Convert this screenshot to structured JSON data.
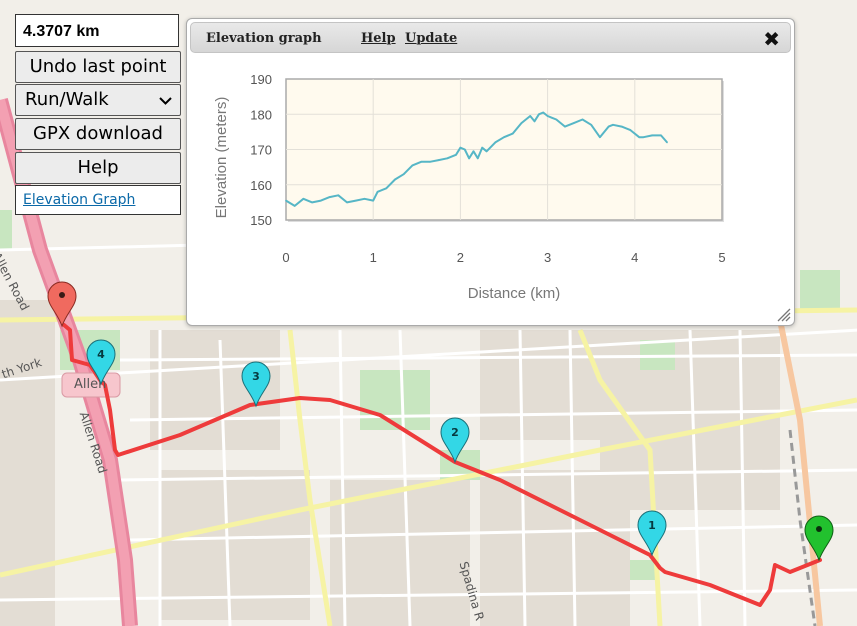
{
  "distance": "4.3707 km",
  "buttons": {
    "undo": "Undo last point",
    "mode": "Run/Walk",
    "gpx": "GPX download",
    "help": "Help"
  },
  "elevation_link": "Elevation Graph",
  "dialog": {
    "title": "Elevation graph",
    "help": "Help",
    "update": "Update",
    "close": "✖"
  },
  "map_labels": {
    "allen_road_north": "Allen Road",
    "allen_road_south": "Allen Road",
    "allen_station": "Allen",
    "north_york": "th York",
    "spadina": "Spadina R"
  },
  "markers": [
    {
      "label": "",
      "kind": "start-red"
    },
    {
      "label": "4",
      "kind": "waypoint"
    },
    {
      "label": "3",
      "kind": "waypoint"
    },
    {
      "label": "2",
      "kind": "waypoint"
    },
    {
      "label": "1",
      "kind": "waypoint"
    },
    {
      "label": "",
      "kind": "end-green"
    }
  ],
  "colors": {
    "route": "#ee3b3b",
    "waypoint": "#33d7e6",
    "start_marker": "#f06a5f",
    "end_marker": "#22c12e",
    "elevation_line": "#56b6c6"
  },
  "chart_data": {
    "type": "line",
    "xlabel": "Distance (km)",
    "ylabel": "Elevation (meters)",
    "xlim": [
      0,
      5
    ],
    "ylim": [
      150,
      190
    ],
    "xticks": [
      "0",
      "1",
      "2",
      "3",
      "4",
      "5"
    ],
    "yticks": [
      "150",
      "160",
      "170",
      "180",
      "190"
    ],
    "grid": true,
    "series": [
      {
        "name": "",
        "x": [
          0,
          0.1,
          0.2,
          0.3,
          0.4,
          0.5,
          0.6,
          0.7,
          0.8,
          0.9,
          1.0,
          1.05,
          1.15,
          1.25,
          1.35,
          1.45,
          1.55,
          1.65,
          1.75,
          1.85,
          1.95,
          2.0,
          2.05,
          2.1,
          2.15,
          2.2,
          2.25,
          2.3,
          2.4,
          2.5,
          2.6,
          2.7,
          2.8,
          2.85,
          2.9,
          2.95,
          3.0,
          3.05,
          3.1,
          3.2,
          3.3,
          3.4,
          3.5,
          3.6,
          3.7,
          3.75,
          3.85,
          3.95,
          4.05,
          4.1,
          4.2,
          4.3,
          4.37
        ],
        "y": [
          155.5,
          154,
          156,
          155,
          155.5,
          156.5,
          157,
          155,
          155.5,
          156,
          155.5,
          158,
          159,
          161.5,
          163,
          165.5,
          166.5,
          166.5,
          167,
          167.5,
          168.5,
          170.5,
          170,
          167.5,
          169.5,
          167.5,
          170.5,
          169.5,
          172,
          173.5,
          174.5,
          177.5,
          179.5,
          178,
          180,
          180.5,
          179.5,
          179,
          178.5,
          176.5,
          177.5,
          178.5,
          177,
          173.5,
          176.5,
          177,
          176.5,
          175.5,
          173.5,
          173.5,
          174,
          174,
          172
        ]
      }
    ]
  }
}
